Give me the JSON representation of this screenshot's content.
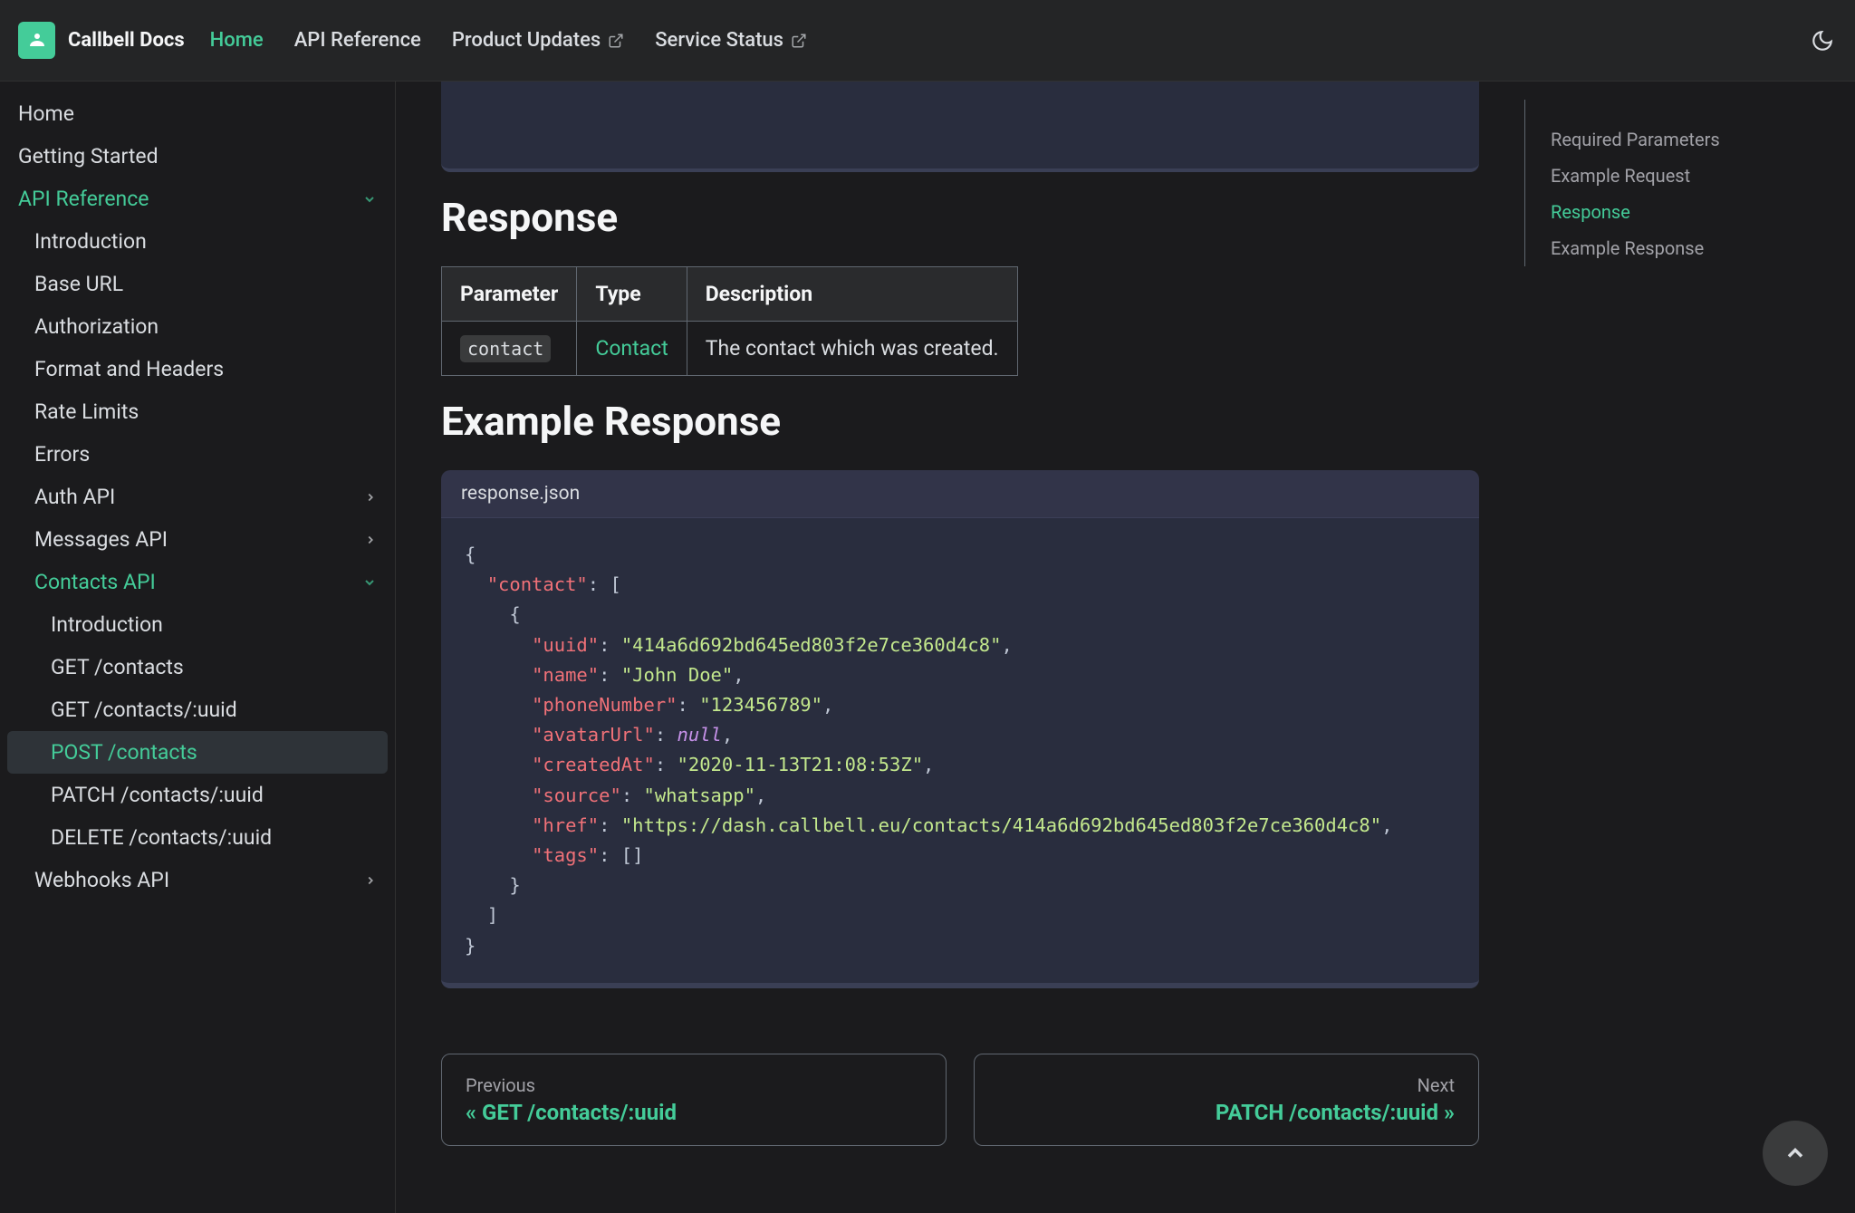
{
  "brand": "Callbell Docs",
  "nav": {
    "home": "Home",
    "api_ref": "API Reference",
    "product_updates": "Product Updates",
    "service_status": "Service Status"
  },
  "sidebar": {
    "home": "Home",
    "getting_started": "Getting Started",
    "api_reference": "API Reference",
    "introduction": "Introduction",
    "base_url": "Base URL",
    "authorization": "Authorization",
    "format_headers": "Format and Headers",
    "rate_limits": "Rate Limits",
    "errors": "Errors",
    "auth_api": "Auth API",
    "messages_api": "Messages API",
    "contacts_api": "Contacts API",
    "contacts_intro": "Introduction",
    "get_contacts": "GET /contacts",
    "get_contacts_uuid": "GET /contacts/:uuid",
    "post_contacts": "POST /contacts",
    "patch_contacts": "PATCH /contacts/:uuid",
    "delete_contacts": "DELETE /contacts/:uuid",
    "webhooks_api": "Webhooks API"
  },
  "headings": {
    "response": "Response",
    "example_response": "Example Response"
  },
  "table": {
    "h_parameter": "Parameter",
    "h_type": "Type",
    "h_description": "Description",
    "r_param": "contact",
    "r_type": "Contact",
    "r_desc": "The contact which was created."
  },
  "code": {
    "filename": "response.json",
    "k_contact": "\"contact\"",
    "k_uuid": "\"uuid\"",
    "k_name": "\"name\"",
    "k_phone": "\"phoneNumber\"",
    "k_avatar": "\"avatarUrl\"",
    "k_created": "\"createdAt\"",
    "k_source": "\"source\"",
    "k_href": "\"href\"",
    "k_tags": "\"tags\"",
    "v_uuid": "\"414a6d692bd645ed803f2e7ce360d4c8\"",
    "v_name": "\"John Doe\"",
    "v_phone": "\"123456789\"",
    "v_null": "null",
    "v_created": "\"2020-11-13T21:08:53Z\"",
    "v_source": "\"whatsapp\"",
    "v_href": "\"https://dash.callbell.eu/contacts/414a6d692bd645ed803f2e7ce360d4c8\""
  },
  "pager": {
    "prev_sub": "Previous",
    "prev_ttl": "« GET /contacts/:uuid",
    "next_sub": "Next",
    "next_ttl": "PATCH /contacts/:uuid »"
  },
  "toc": {
    "required_params": "Required Parameters",
    "example_request": "Example Request",
    "response": "Response",
    "example_response": "Example Response"
  }
}
